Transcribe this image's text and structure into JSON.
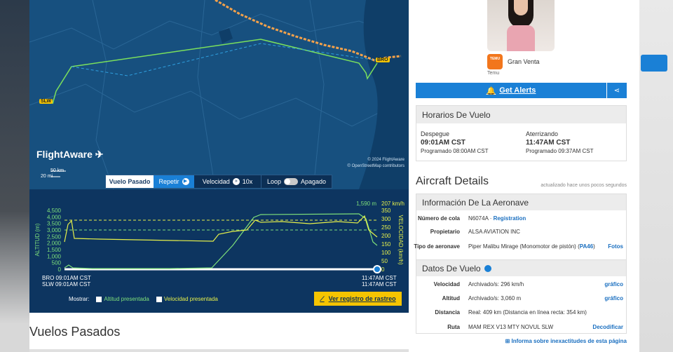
{
  "map": {
    "brand": "FlightAware",
    "scale_km": "50 km",
    "scale_mi": "20 mi",
    "credit_1": "© 2024 FlightAware",
    "credit_2": "© OpenStreetMap contributors",
    "origin_code": "BRO",
    "dest_code": "SLW"
  },
  "controls": {
    "past": "Vuelo Pasado",
    "repeat": "Repetir",
    "speed_label": "Velocidad",
    "speed_value": "10x",
    "loop_label": "Loop",
    "loop_state": "Apagado"
  },
  "graph": {
    "left_axis_label": "ALTITUD (m)",
    "right_axis_label": "VELOCIDAD (km/h)",
    "alt_ticks": [
      "4,500",
      "4,000",
      "3,500",
      "3,000",
      "2,500",
      "2,000",
      "1,500",
      "1,000",
      "500",
      "0"
    ],
    "spd_ticks": [
      "350",
      "300",
      "250",
      "200",
      "150",
      "100",
      "50",
      "0"
    ],
    "current_alt": "1,590 m",
    "current_spd": "207 km/h",
    "left_times": [
      "BRO 09:01AM CST",
      "SLW 09:01AM CST"
    ],
    "right_times": [
      "11:47AM CST",
      "11:47AM CST"
    ],
    "show_label": "Mostrar:",
    "show_alt": "Altitud presentada",
    "show_spd": "Velocidad presentada",
    "track_button": "Ver registro de rastreo"
  },
  "lower": {
    "heading": "Vuelos Pasados"
  },
  "ad": {
    "brand_caption": "Temu",
    "logo_text": "TEMU",
    "title": "Gran Venta"
  },
  "alerts": {
    "label": "Get Alerts"
  },
  "schedule": {
    "title": "Horarios De Vuelo",
    "dep_label": "Despegue",
    "dep_time": "09:01AM CST",
    "dep_sched": "Programado 08:00AM CST",
    "arr_label": "Aterrizando",
    "arr_time": "11:47AM CST",
    "arr_sched": "Programado 09:37AM CST"
  },
  "aircraft": {
    "title": "Aircraft Details",
    "updated": "actualizado hace unos pocos segundos",
    "info_title": "Información De La Aeronave",
    "tail_k": "Número de cola",
    "tail_v": "N6074A",
    "tail_sep": " · ",
    "tail_link": "Registration",
    "owner_k": "Propietario",
    "owner_v": "ALSA AVIATION INC",
    "type_k": "Tipo de aeronave",
    "type_v": "Piper Malibu Mirage (Monomotor de pistón) (",
    "type_code": "PA46",
    "type_end": ")",
    "photos": "Fotos"
  },
  "flight": {
    "title": "Datos De Vuelo",
    "speed_k": "Velocidad",
    "speed_v": "Archivado/s: 296 km/h",
    "alt_k": "Altitud",
    "alt_v": "Archivado/s: 3,060 m",
    "dist_k": "Distancia",
    "dist_v": "Real: 409 km (Distancia en línea recta: 354 km)",
    "route_k": "Ruta",
    "route_v": "MAM REX V13 MTY NOVUL SLW",
    "graph_link": "gráfico",
    "decode_link": "Decodificar"
  },
  "report": "Informa sobre inexactitudes de esta página",
  "colors": {
    "accent": "#1a80d6",
    "altitude": "#7ee07a",
    "speed": "#e6f04a",
    "map_bg": "#17507f",
    "track_btn": "#f5c400"
  }
}
